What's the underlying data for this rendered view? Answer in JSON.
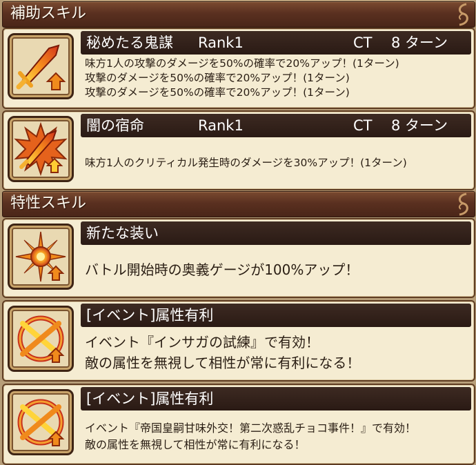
{
  "sections": {
    "support": {
      "title": "補助スキル"
    },
    "trait": {
      "title": "特性スキル"
    }
  },
  "skills": [
    {
      "name": "秘めたる鬼謀",
      "rank": "Rank1",
      "ct_label": "CT",
      "ct_value": "8 ターン",
      "icon": "flaming-sword-up-arrow-icon",
      "lines": [
        "味方1人の攻撃のダメージを50%の確率で20%アップ！(1ターン)",
        "攻撃のダメージを50%の確率で20%アップ！(1ターン)",
        "攻撃のダメージを50%の確率で20%アップ！(1ターン)"
      ]
    },
    {
      "name": "闇の宿命",
      "rank": "Rank1",
      "ct_label": "CT",
      "ct_value": "8 ターン",
      "icon": "burst-sword-up-arrow-icon",
      "lines": [
        "味方1人のクリティカル発生時のダメージを30%アップ！(1ターン)"
      ]
    }
  ],
  "traits": [
    {
      "name": "新たな装い",
      "icon": "compass-star-up-arrow-icon",
      "lines": [
        "バトル開始時の奥義ゲージが100%アップ！"
      ]
    },
    {
      "name": "[イベント]属性有利",
      "icon": "cross-circle-up-arrow-icon",
      "lines": [
        "イベント『インサガの試練』で有効！",
        "敵の属性を無視して相性が常に有利になる！"
      ]
    },
    {
      "name": "[イベント]属性有利",
      "icon": "cross-circle-up-arrow-icon",
      "lines": [
        "イベント『帝国皇嗣甘味外交！第二次惑乱チョコ事件！』で有効！",
        "敵の属性を無視して相性が常に有利になる！"
      ]
    }
  ],
  "colors": {
    "header": "#5a3020",
    "card_bg": "#f5ecd2",
    "name_bar": "#2a1a14",
    "icon_orange": "#f08a1c",
    "icon_red": "#c8321a"
  }
}
